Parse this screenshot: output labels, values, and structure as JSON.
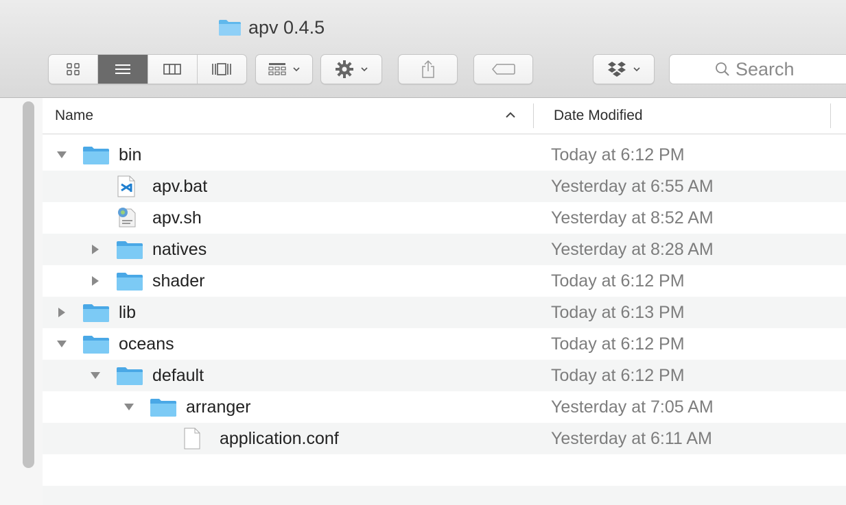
{
  "window": {
    "title": "apv 0.4.5",
    "title_icon": "folder-icon"
  },
  "toolbar": {
    "view_buttons": [
      {
        "name": "icon-view",
        "icon": "grid-icon",
        "active": false
      },
      {
        "name": "list-view",
        "icon": "list-icon",
        "active": true
      },
      {
        "name": "column-view",
        "icon": "columns-icon",
        "active": false
      },
      {
        "name": "cover-flow-view",
        "icon": "cover-flow-icon",
        "active": false
      }
    ],
    "arrange_icon": "arrange-icon",
    "action_icon": "gear-icon",
    "share_icon": "share-icon",
    "tags_icon": "tag-icon",
    "dropbox_icon": "dropbox-icon",
    "search_placeholder": "Search"
  },
  "columns": {
    "name": "Name",
    "date_modified": "Date Modified",
    "sort_direction": "ascending"
  },
  "colors": {
    "folder_blue": "#5fb8ec",
    "active_segment": "#6b6b6b",
    "date_text": "#7d7d7d",
    "alt_row": "#f4f5f5"
  },
  "rows": [
    {
      "name": "bin",
      "date": "Today at 6:12 PM",
      "kind": "folder",
      "depth": 0,
      "disclosure": "expanded"
    },
    {
      "name": "apv.bat",
      "date": "Yesterday at 6:55 AM",
      "kind": "vscode-file",
      "depth": 1,
      "disclosure": "none"
    },
    {
      "name": "apv.sh",
      "date": "Yesterday at 8:52 AM",
      "kind": "script-file",
      "depth": 1,
      "disclosure": "none"
    },
    {
      "name": "natives",
      "date": "Yesterday at 8:28 AM",
      "kind": "folder",
      "depth": 1,
      "disclosure": "collapsed"
    },
    {
      "name": "shader",
      "date": "Today at 6:12 PM",
      "kind": "folder",
      "depth": 1,
      "disclosure": "collapsed"
    },
    {
      "name": "lib",
      "date": "Today at 6:13 PM",
      "kind": "folder",
      "depth": 0,
      "disclosure": "collapsed"
    },
    {
      "name": "oceans",
      "date": "Today at 6:12 PM",
      "kind": "folder",
      "depth": 0,
      "disclosure": "expanded"
    },
    {
      "name": "default",
      "date": "Today at 6:12 PM",
      "kind": "folder",
      "depth": 1,
      "disclosure": "expanded"
    },
    {
      "name": "arranger",
      "date": "Yesterday at 7:05 AM",
      "kind": "folder",
      "depth": 2,
      "disclosure": "expanded"
    },
    {
      "name": "application.conf",
      "date": "Yesterday at 6:11 AM",
      "kind": "document",
      "depth": 3,
      "disclosure": "none"
    }
  ]
}
